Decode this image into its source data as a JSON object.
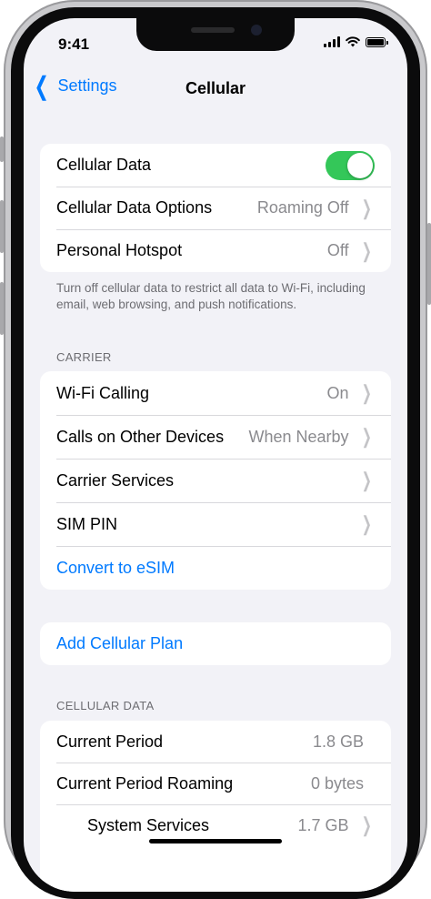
{
  "status_bar": {
    "time": "9:41"
  },
  "nav": {
    "back_label": "Settings",
    "title": "Cellular"
  },
  "group1": {
    "rows": [
      {
        "label": "Cellular Data",
        "toggle_on": true
      },
      {
        "label": "Cellular Data Options",
        "value": "Roaming Off"
      },
      {
        "label": "Personal Hotspot",
        "value": "Off"
      }
    ],
    "footnote": "Turn off cellular data to restrict all data to Wi-Fi, including email, web browsing, and push notifications."
  },
  "carrier": {
    "header": "CARRIER",
    "rows": [
      {
        "label": "Wi-Fi Calling",
        "value": "On"
      },
      {
        "label": "Calls on Other Devices",
        "value": "When Nearby"
      },
      {
        "label": "Carrier Services"
      },
      {
        "label": "SIM PIN"
      },
      {
        "label": "Convert to eSIM"
      }
    ]
  },
  "add_plan": {
    "label": "Add Cellular Plan"
  },
  "cellular_data": {
    "header": "CELLULAR DATA",
    "rows": [
      {
        "label": "Current Period",
        "value": "1.8 GB"
      },
      {
        "label": "Current Period Roaming",
        "value": "0 bytes"
      },
      {
        "label": "System Services",
        "value": "1.7 GB"
      }
    ]
  },
  "colors": {
    "accent": "#007aff",
    "toggle_on": "#34c759",
    "background": "#f2f2f7"
  }
}
